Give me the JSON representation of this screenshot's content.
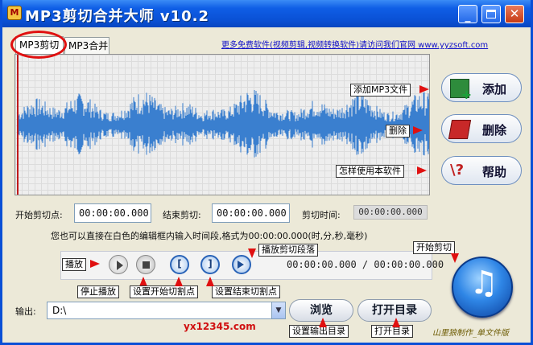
{
  "window": {
    "title": "MP3剪切合并大师 v10.2",
    "icon_glyph": "M",
    "controls": {
      "minimize": "_",
      "close": "✕"
    }
  },
  "tabs": [
    {
      "label": "MP3剪切",
      "active": true
    },
    {
      "label": "MP3合并",
      "active": false
    }
  ],
  "top_link": "更多免费软件(视频剪辑,视频转换软件)请访问我们官网 www.yyzsoft.com",
  "side_buttons": {
    "add": "添加",
    "delete": "删除",
    "help": "帮助",
    "help_icon_glyph": "\\?"
  },
  "time_fields": {
    "start_label": "开始剪切点:",
    "start_value": "00:00:00.000",
    "end_label": "结束剪切:",
    "end_value": "00:00:00.000",
    "cut_time_label": "剪切时间:",
    "cut_time_value": "00:00:00.000"
  },
  "hint": "您也可以直接在白色的编辑框内输入时间段,格式为00:00:00.000(时,分,秒,毫秒)",
  "player": {
    "mark_start_glyph": "[",
    "mark_end_glyph": "]",
    "time_range": "00:00:00.000 / 00:00:00.000"
  },
  "big_cut_glyph": "♫",
  "output": {
    "label": "输出:",
    "path": "D:\\",
    "dropdown_glyph": "▼",
    "browse": "浏览",
    "open_dir": "打开目录"
  },
  "annotations": {
    "add_mp3": "添加MP3文件",
    "delete": "删除",
    "how_to_use": "怎样使用本软件",
    "play": "播放",
    "play_segment": "播放剪切段落",
    "start_cut": "开始剪切",
    "stop_play": "停止播放",
    "set_start": "设置开始切割点",
    "set_end": "设置结束切割点",
    "set_output": "设置输出目录",
    "open_dir": "打开目录"
  },
  "watermark": "yx12345.com",
  "signature": "山里狼制作_单文件版",
  "colors": {
    "titlebar": "#0a50d4",
    "waveform": "#3a7fcf",
    "cursor": "#c01818",
    "annotation_arrow": "#e01010",
    "link": "#1010c8"
  }
}
